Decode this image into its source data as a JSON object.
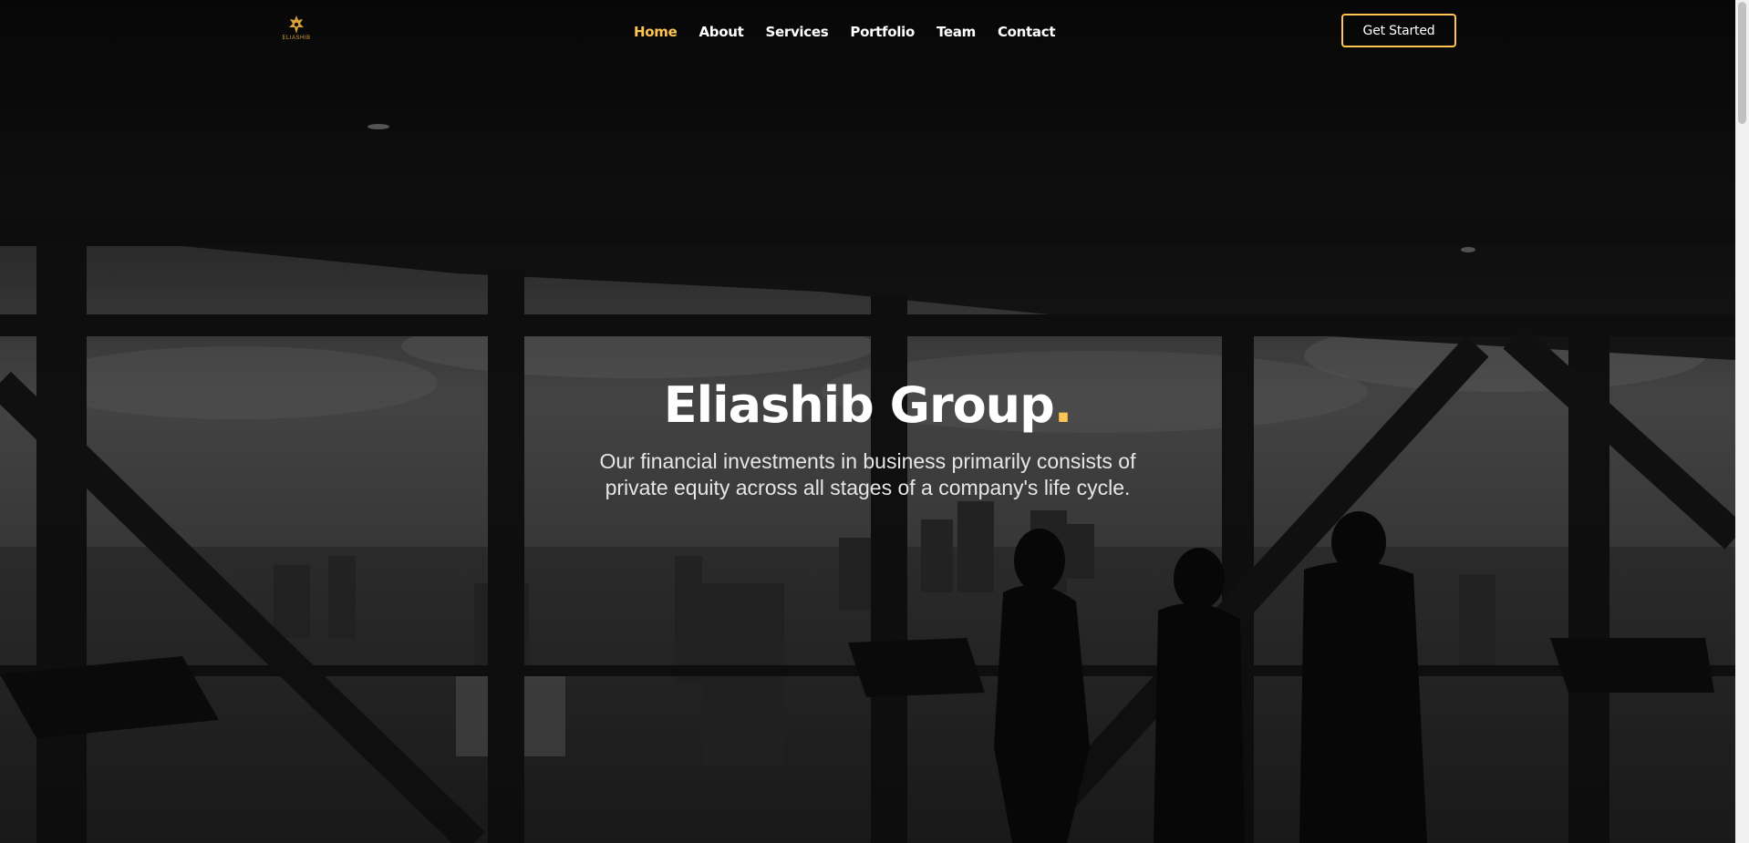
{
  "header": {
    "logo_text": "ELIASHIB",
    "nav": [
      {
        "label": "Home",
        "active": true
      },
      {
        "label": "About",
        "active": false
      },
      {
        "label": "Services",
        "active": false
      },
      {
        "label": "Portfolio",
        "active": false
      },
      {
        "label": "Team",
        "active": false
      },
      {
        "label": "Contact",
        "active": false
      }
    ],
    "cta_label": "Get Started"
  },
  "hero": {
    "title": "Eliashib Group",
    "title_dot": ".",
    "subtitle": "Our financial investments in business primarily consists of private equity across all stages of a company's life cycle."
  },
  "colors": {
    "accent": "#ffc451",
    "text": "#ffffff",
    "background": "#0b0b0b"
  },
  "icons": {
    "logo": "eliashib-emblem-icon"
  }
}
